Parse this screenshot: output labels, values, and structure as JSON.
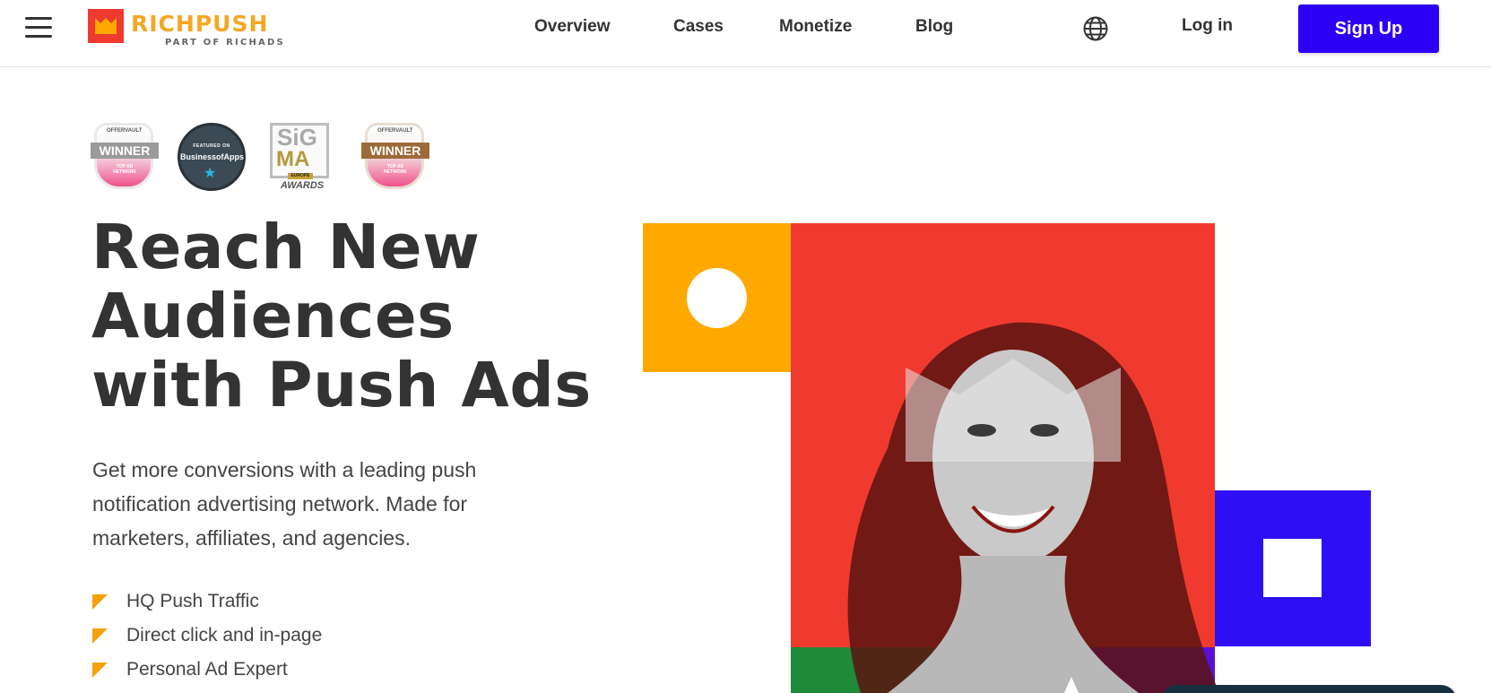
{
  "header": {
    "logo": {
      "name": "RICHPUSH",
      "tagline": "PART OF RICHADS",
      "brand_color": "#f03a2f",
      "accent_color": "#f5a623"
    },
    "nav": [
      {
        "label": "Overview"
      },
      {
        "label": "Cases"
      },
      {
        "label": "Monetize"
      },
      {
        "label": "Blog"
      }
    ],
    "language_icon": "globe-icon",
    "login_label": "Log in",
    "signup_label": "Sign Up",
    "signup_color": "#2c00f5"
  },
  "awards": [
    {
      "name": "offervault-winner-badge",
      "top": "OFFERVAULT",
      "title": "WINNER",
      "sub": "TOP AD NETWORK"
    },
    {
      "name": "businessofapps-badge",
      "top": "FEATURED ON",
      "title": "BusinessofApps"
    },
    {
      "name": "sigma-europe-badge",
      "top": "SiG",
      "title": "MA",
      "sub": "EUROPE",
      "footer": "AWARDS"
    },
    {
      "name": "offervault-winner-badge-2",
      "top": "OFFERVAULT",
      "title": "WINNER",
      "sub": "TOP AD NETWORK"
    }
  ],
  "hero": {
    "headline_lines": [
      "Reach New",
      "Audiences",
      "with Push Ads"
    ],
    "subtext": "Get more conversions with a leading push notification advertising network. Made for marketers, affiliates, and agencies.",
    "features": [
      "HQ Push Traffic",
      "Direct click and in-page",
      "Personal Ad Expert"
    ],
    "colors": {
      "yellow": "#ffa900",
      "red": "#f03a2f",
      "blue": "#2e0ff5",
      "green": "#1f8a3a",
      "purple": "#5b0fd6"
    }
  }
}
